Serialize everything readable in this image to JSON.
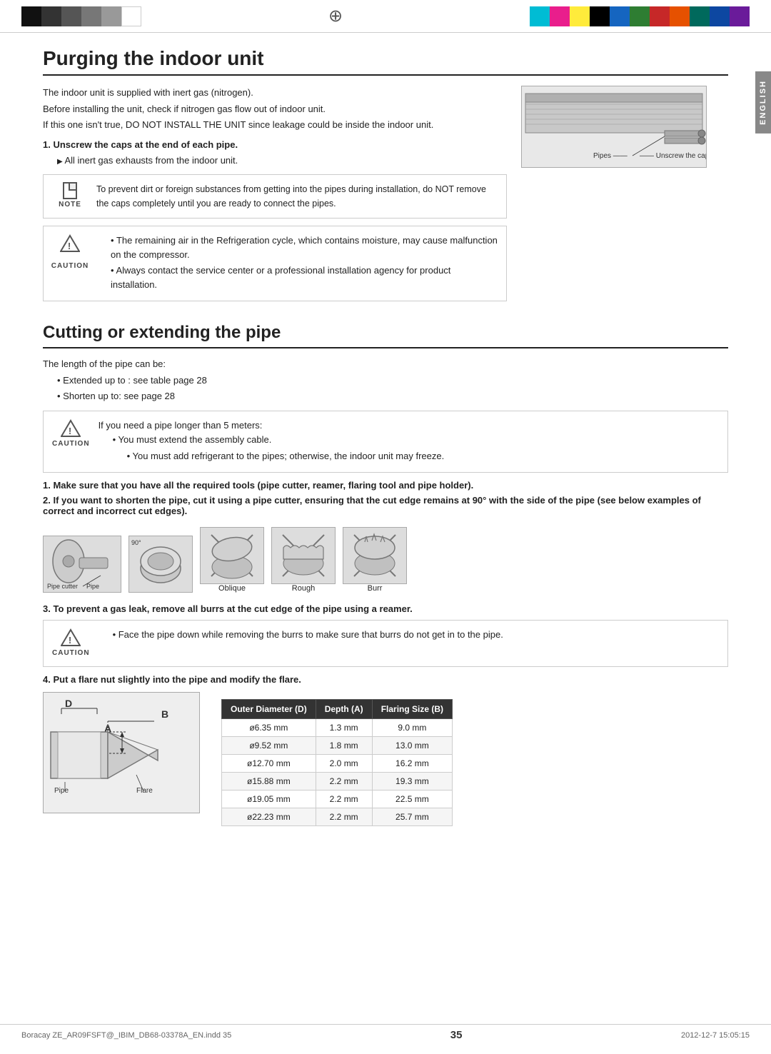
{
  "topBar": {
    "crosshair": "⊕"
  },
  "sidebar": {
    "label": "ENGLISH"
  },
  "section1": {
    "title": "Purging the indoor unit",
    "intro": [
      "The indoor unit is supplied with inert gas  (nitrogen).",
      "Before installing the unit, check if nitrogen gas flow out of indoor unit.",
      "If this one isn't true, DO NOT INSTALL THE UNIT since leakage could be inside the indoor unit."
    ],
    "step1_label": "1.  Unscrew the caps at the end of each pipe.",
    "step1_bullet": "All inert gas exhausts from the indoor unit.",
    "note_text": "To prevent dirt or foreign substances from getting into the pipes during installation, do NOT remove the caps completely until you are ready to connect the pipes.",
    "note_label": "NOTE",
    "caution_lines": [
      "The remaining air in the Refrigeration cycle, which contains moisture, may cause malfunction on the compressor.",
      "Always contact the service center or a professional installation agency for product installation."
    ],
    "caution_label": "CAUTION",
    "diagram_label_pipes": "Pipes",
    "diagram_label_caps": "Unscrew the caps"
  },
  "section2": {
    "title": "Cutting or extending the pipe",
    "intro": "The length of the pipe can be:",
    "bullets": [
      "Extended up to : see table page 28",
      "Shorten up to: see page 28"
    ],
    "caution_label": "CAUTION",
    "caution_lines": [
      "If you need a pipe longer than 5 meters:",
      "You must extend the assembly cable.",
      "You must add refrigerant to the pipes; otherwise, the indoor unit may freeze."
    ],
    "step2_label": "1.",
    "step2_text": "Make sure that you have all the required tools (pipe cutter, reamer, flaring tool and pipe holder).",
    "step3_label": "2.",
    "step3_text": "If you want to shorten the pipe, cut it using a pipe cutter, ensuring that the cut edge remains at 90° with the side of the pipe (see below examples of correct and incorrect cut edges).",
    "diagrams": [
      {
        "label": "Pipe\ncutter",
        "sublabel": "Pipe"
      },
      {
        "label": "90°"
      },
      {
        "label": "Oblique"
      },
      {
        "label": "Rough"
      },
      {
        "label": "Burr"
      }
    ],
    "step4_label": "3.",
    "step4_text": "To prevent a gas leak, remove all burrs at the cut edge of the pipe using a reamer.",
    "caution2_label": "CAUTION",
    "caution2_text": "Face the pipe down while removing the burrs to make sure that burrs do not get in to the pipe.",
    "step5_label": "4.",
    "step5_text": "Put a flare nut slightly into the pipe and modify the flare.",
    "table": {
      "headers": [
        "Outer Diameter (D)",
        "Depth (A)",
        "Flaring Size (B)"
      ],
      "rows": [
        [
          "ø6.35 mm",
          "1.3 mm",
          "9.0 mm"
        ],
        [
          "ø9.52 mm",
          "1.8 mm",
          "13.0 mm"
        ],
        [
          "ø12.70 mm",
          "2.0 mm",
          "16.2 mm"
        ],
        [
          "ø15.88 mm",
          "2.2 mm",
          "19.3 mm"
        ],
        [
          "ø19.05 mm",
          "2.2 mm",
          "22.5 mm"
        ],
        [
          "ø22.23 mm",
          "2.2 mm",
          "25.7 mm"
        ]
      ]
    },
    "diagram_pipe_label": "Pipe",
    "diagram_flare_label": "Flare",
    "diagram_d_label": "D",
    "diagram_a_label": "A",
    "diagram_b_label": "B"
  },
  "footer": {
    "left": "Boracay ZE_AR09FSFT@_IBIM_DB68-03378A_EN.indd   35",
    "right": "2012-12-7   15:05:15",
    "pageNum": "35"
  }
}
